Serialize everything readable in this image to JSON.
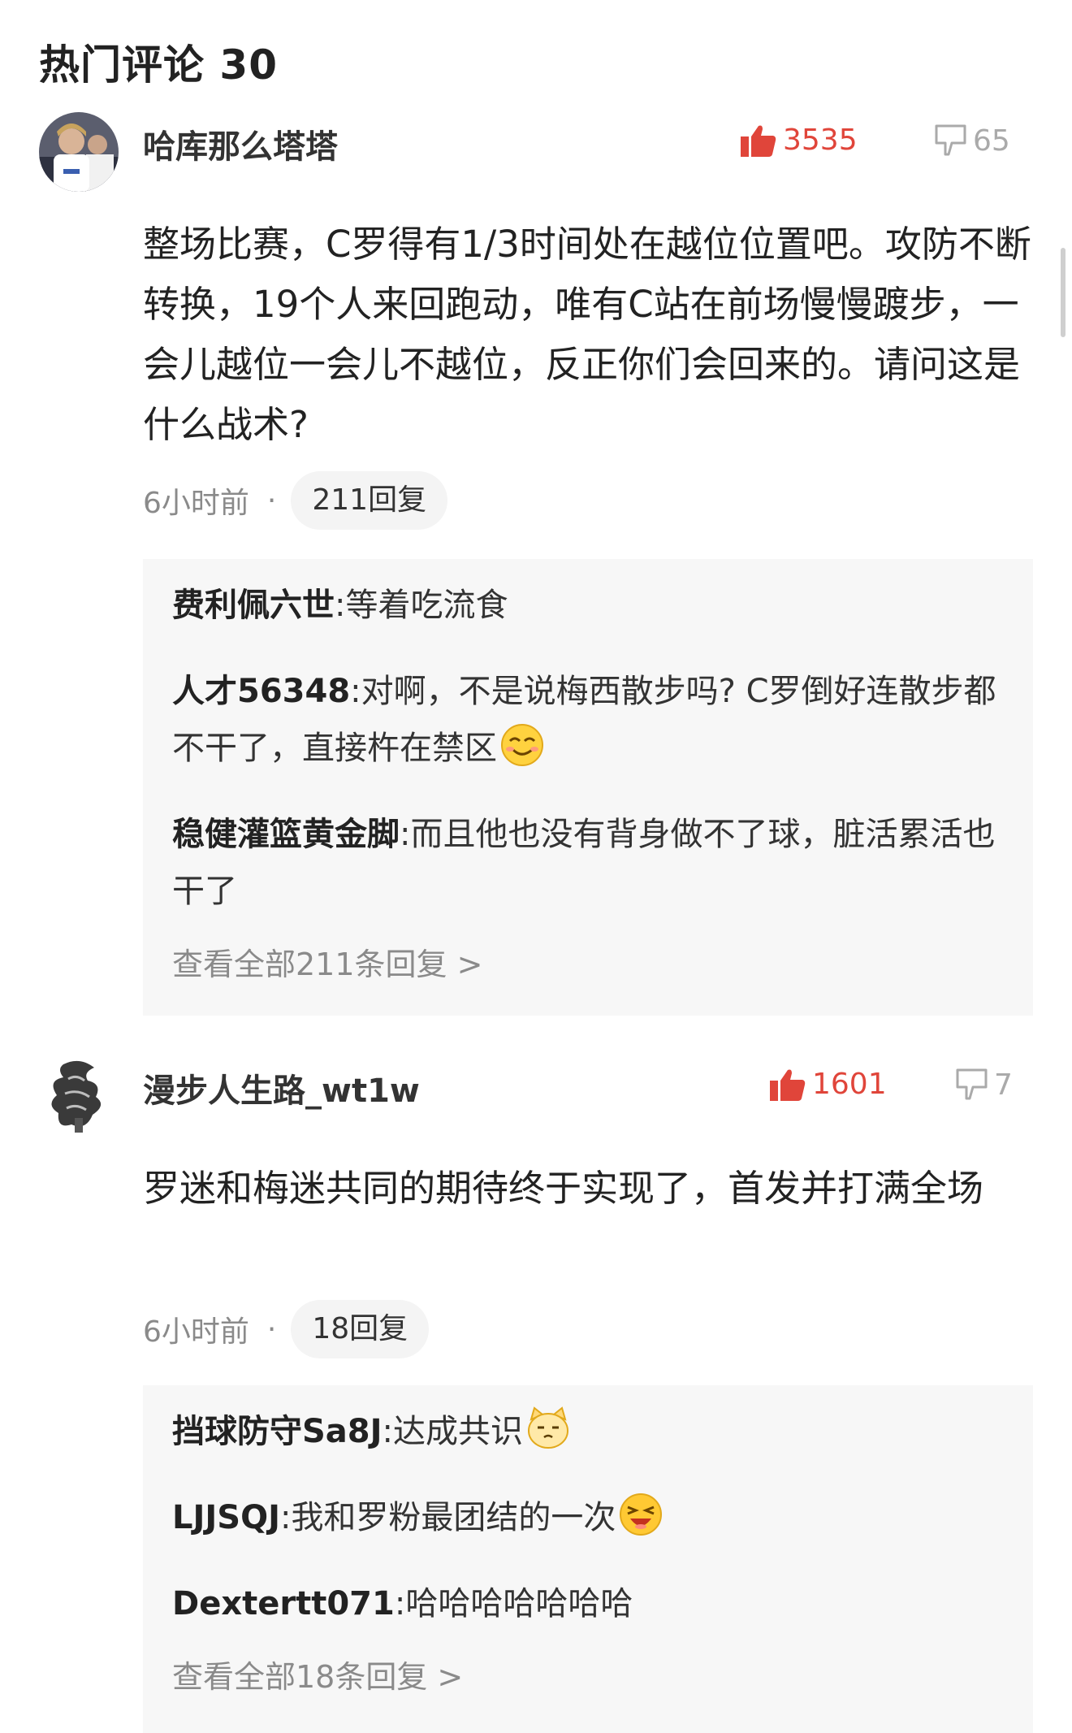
{
  "header": {
    "title": "热门评论 30"
  },
  "comments": [
    {
      "username": "哈库那么塔塔",
      "likes": "3535",
      "dislikes": "65",
      "text": "整场比赛，C罗得有1/3时间处在越位位置吧。攻防不断转换，19个人来回跑动，唯有C站在前场慢慢踱步，一会儿越位一会儿不越位，反正你们会回来的。请问这是什么战术?",
      "time": "6小时前",
      "dot": "·",
      "reply_count_label": "211回复",
      "replies": [
        {
          "name": "费利佩六世",
          "sep": ":",
          "text": "等着吃流食"
        },
        {
          "name": "人才56348",
          "sep": ":",
          "text": "对啊，不是说梅西散步吗? C罗倒好连散步都不干了，直接杵在禁区"
        },
        {
          "name": "稳健灌篮黄金脚",
          "sep": ":",
          "text": "而且他也没有背身做不了球，脏活累活也干了"
        }
      ],
      "view_all": "查看全部211条回复 >"
    },
    {
      "username": "漫步人生路_wt1w",
      "likes": "1601",
      "dislikes": "7",
      "text": "罗迷和梅迷共同的期待终于实现了，首发并打满全场",
      "time": "6小时前",
      "dot": "·",
      "reply_count_label": "18回复",
      "replies": [
        {
          "name": "挡球防守Sa8J",
          "sep": ":",
          "text": "达成共识"
        },
        {
          "name": "LJJSQJ",
          "sep": ":",
          "text": "我和罗粉最团结的一次"
        },
        {
          "name": "Dextertt071",
          "sep": ":",
          "text": "哈哈哈哈哈哈哈"
        }
      ],
      "view_all": "查看全部18条回复 >"
    }
  ],
  "colors": {
    "like": "#e0453a",
    "muted": "#8a8a8a",
    "reply_bg": "#f7f7f7",
    "pill_bg": "#f4f4f4"
  }
}
